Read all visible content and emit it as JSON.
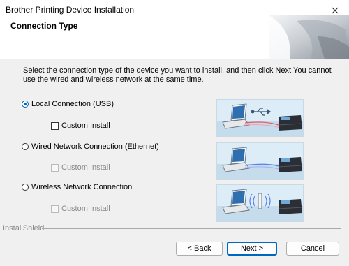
{
  "window": {
    "title": "Brother Printing Device Installation"
  },
  "header": {
    "title": "Connection Type"
  },
  "instructions": "Select the connection type of the device you want to install, and then click Next.You cannot use the wired and wireless network at the same time.",
  "options": [
    {
      "label": "Local Connection (USB)",
      "selected": true,
      "custom_install_label": "Custom Install",
      "custom_install_enabled": true
    },
    {
      "label": "Wired Network Connection (Ethernet)",
      "selected": false,
      "custom_install_label": "Custom Install",
      "custom_install_enabled": false
    },
    {
      "label": "Wireless Network Connection",
      "selected": false,
      "custom_install_label": "Custom Install",
      "custom_install_enabled": false
    }
  ],
  "footer": {
    "brand": "InstallShield",
    "back_label": "< Back",
    "next_label": "Next >",
    "cancel_label": "Cancel"
  },
  "colors": {
    "accent": "#0067c0",
    "usb_line": "#e85a6a",
    "ethernet_line": "#5a7fe8"
  },
  "icons": [
    "close-icon",
    "usb-icon",
    "wifi-icon",
    "laptop-icon",
    "printer-icon"
  ]
}
